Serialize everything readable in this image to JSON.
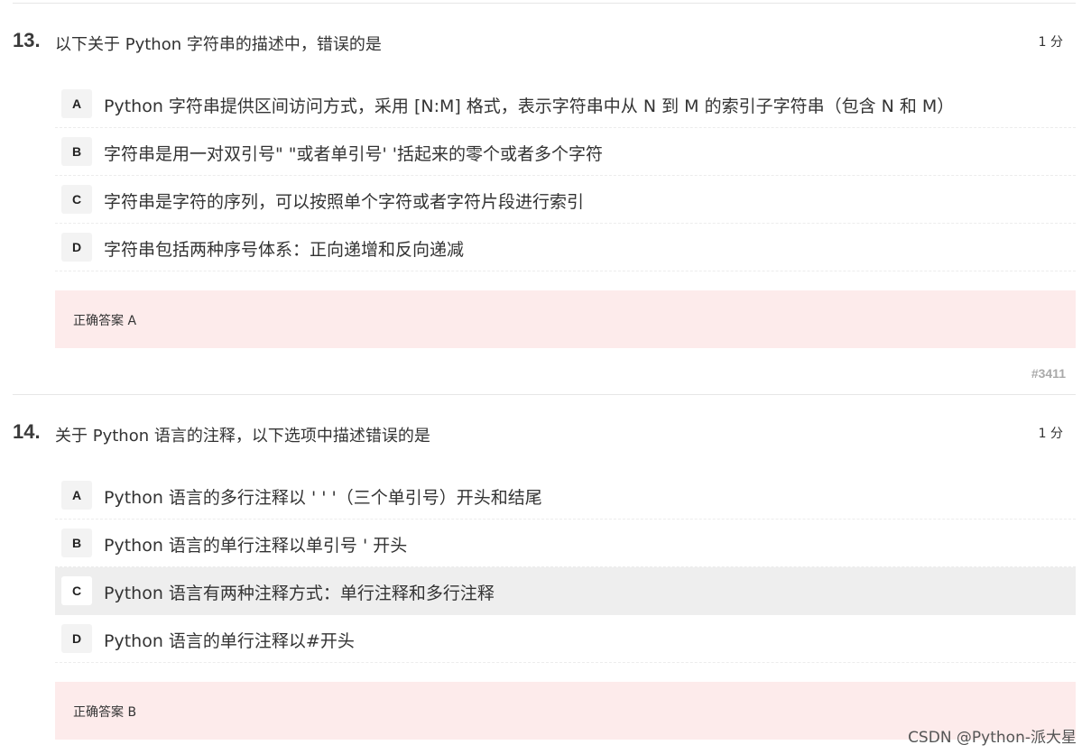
{
  "questions": [
    {
      "number": "13.",
      "text": "以下关于 Python 字符串的描述中，错误的是",
      "score": "1 分",
      "options": [
        {
          "letter": "A",
          "text": "Python 字符串提供区间访问方式，采用 [N:M] 格式，表示字符串中从 N 到 M 的索引子字符串（包含 N 和 M）"
        },
        {
          "letter": "B",
          "text": "字符串是用一对双引号\" \"或者单引号' '括起来的零个或者多个字符"
        },
        {
          "letter": "C",
          "text": "字符串是字符的序列，可以按照单个字符或者字符片段进行索引"
        },
        {
          "letter": "D",
          "text": "字符串包括两种序号体系：正向递增和反向递减"
        }
      ],
      "answer": "正确答案 A",
      "id": "#3411"
    },
    {
      "number": "14.",
      "text": "关于 Python 语言的注释，以下选项中描述错误的是",
      "score": "1 分",
      "options": [
        {
          "letter": "A",
          "text": "Python 语言的多行注释以 ' ' '（三个单引号）开头和结尾"
        },
        {
          "letter": "B",
          "text": "Python 语言的单行注释以单引号 ' 开头"
        },
        {
          "letter": "C",
          "text": "Python 语言有两种注释方式：单行注释和多行注释",
          "highlighted": true
        },
        {
          "letter": "D",
          "text": "Python 语言的单行注释以#开头"
        }
      ],
      "answer": "正确答案 B"
    }
  ],
  "watermark": "CSDN @Python-派大星"
}
